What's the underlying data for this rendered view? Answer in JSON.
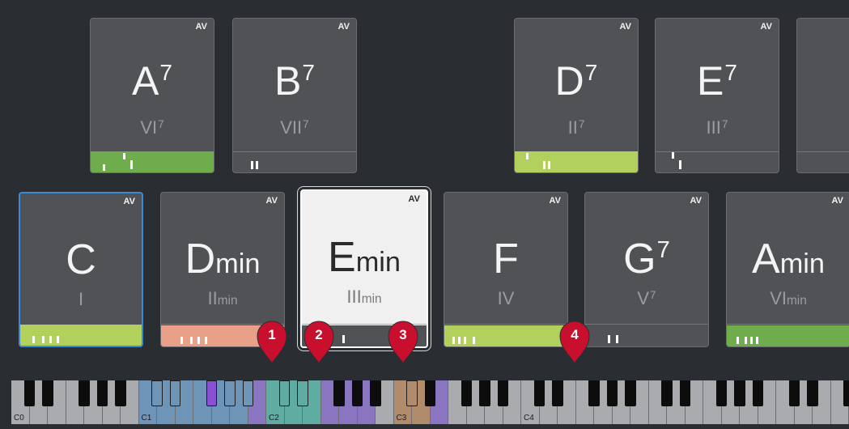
{
  "colors": {
    "background": "#2a2d32",
    "pad": "#505256",
    "pad_active": "#f0f0f0",
    "pad_selected_border": "#3a8ad6",
    "marker": "#c8102e",
    "voicing_green_light": "#b2d05c",
    "voicing_green_dark": "#6fad4c",
    "voicing_salmon": "#e8a089",
    "voicing_gray": "#505256",
    "key_white": "#a9abae",
    "key_black": "#0d0d0d",
    "key_blue": "#6e94b8",
    "key_teal": "#5faca2",
    "key_purple": "#8a76c0",
    "key_deep_purple": "#8b4fd4",
    "key_brown": "#b08c6c"
  },
  "pads_top": [
    {
      "root": "A",
      "ext": "7",
      "suffix": "",
      "degree": "VI",
      "degree_ext": "7",
      "degree_suffix": "",
      "av": "AV",
      "voicing_color": "#6fad4c"
    },
    {
      "root": "B",
      "ext": "7",
      "suffix": "",
      "degree": "VII",
      "degree_ext": "7",
      "degree_suffix": "",
      "av": "AV",
      "voicing_color": "#505256"
    },
    {
      "root": "D",
      "ext": "7",
      "suffix": "",
      "degree": "II",
      "degree_ext": "7",
      "degree_suffix": "",
      "av": "AV",
      "voicing_color": "#b2d05c"
    },
    {
      "root": "E",
      "ext": "7",
      "suffix": "",
      "degree": "III",
      "degree_ext": "7",
      "degree_suffix": "",
      "av": "AV",
      "voicing_color": "#505256"
    },
    {
      "root": "",
      "ext": "",
      "suffix": "",
      "degree": "",
      "degree_ext": "",
      "degree_suffix": "",
      "av": "",
      "voicing_color": "#505256"
    }
  ],
  "pads_bottom": [
    {
      "root": "C",
      "ext": "",
      "suffix": "",
      "degree": "I",
      "degree_ext": "",
      "degree_suffix": "",
      "av": "AV",
      "voicing_color": "#b2d05c"
    },
    {
      "root": "D",
      "ext": "",
      "suffix": "min",
      "degree": "II",
      "degree_ext": "",
      "degree_suffix": "min",
      "av": "AV",
      "voicing_color": "#e8a089"
    },
    {
      "root": "E",
      "ext": "",
      "suffix": "min",
      "degree": "III",
      "degree_ext": "",
      "degree_suffix": "min",
      "av": "AV",
      "voicing_color": "#505256"
    },
    {
      "root": "F",
      "ext": "",
      "suffix": "",
      "degree": "IV",
      "degree_ext": "",
      "degree_suffix": "",
      "av": "AV",
      "voicing_color": "#b2d05c"
    },
    {
      "root": "G",
      "ext": "7",
      "suffix": "",
      "degree": "V",
      "degree_ext": "7",
      "degree_suffix": "",
      "av": "AV",
      "voicing_color": "#505256"
    },
    {
      "root": "A",
      "ext": "",
      "suffix": "min",
      "degree": "VI",
      "degree_ext": "",
      "degree_suffix": "min",
      "av": "AV",
      "voicing_color": "#6fad4c"
    }
  ],
  "markers": [
    "1",
    "2",
    "3",
    "4"
  ],
  "keyboard": {
    "octave_labels": [
      "C0",
      "C1",
      "C2",
      "C3",
      "C4"
    ]
  }
}
